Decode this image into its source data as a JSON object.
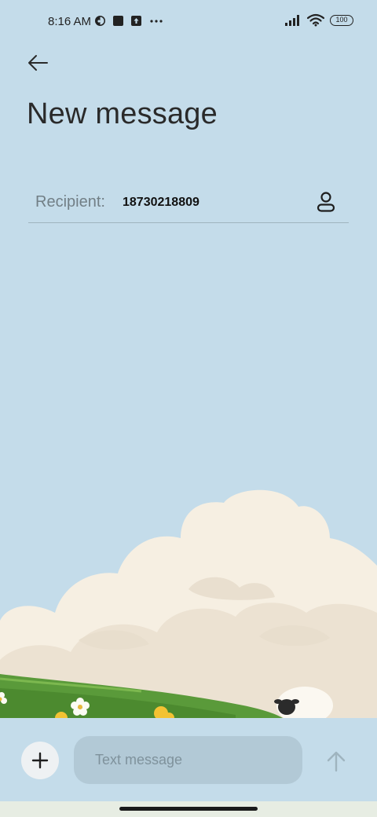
{
  "status_bar": {
    "time": "8:16 AM",
    "left_icons": [
      "vpn-key-icon",
      "square-app-icon",
      "upload-icon",
      "more-dots-icon"
    ],
    "right_icons": [
      "signal-icon",
      "wifi-icon",
      "battery-icon"
    ],
    "battery_level": "100"
  },
  "header": {
    "back_icon": "arrow-left-icon",
    "title": "New message"
  },
  "recipient": {
    "label": "Recipient:",
    "value": "18730218809",
    "contact_icon": "person-icon"
  },
  "compose": {
    "attach_icon": "plus-icon",
    "placeholder": "Text message",
    "value": "",
    "send_icon": "arrow-up-icon"
  },
  "colors": {
    "background": "#c4dcea",
    "input_background": "#b2c9d6",
    "attach_button": "#eef1f3",
    "clouds": "#f6efe2",
    "grass": "#5a9a3a"
  }
}
